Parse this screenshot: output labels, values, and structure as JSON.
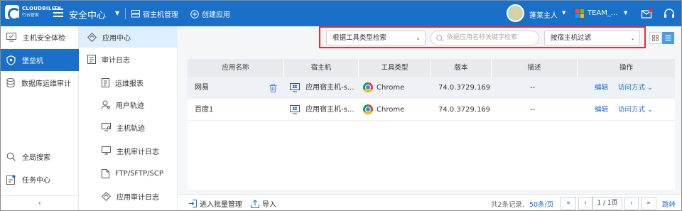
{
  "app": {
    "logo_line1": "CLOUDBILITY",
    "logo_line2": "行云管家",
    "section_title": "安全中心",
    "host_mgmt_label": "宿主机管理",
    "create_app_label": "创建应用",
    "user_name": "蓬莱主人",
    "team_label": "TEAM_..."
  },
  "sidebar": {
    "items": [
      {
        "label": "主机安全体检",
        "icon": "monitor-check-icon"
      },
      {
        "label": "堡垒机",
        "icon": "shield-icon",
        "active": true
      },
      {
        "label": "数据库运维审计",
        "icon": "database-icon"
      },
      {
        "label": "全局搜索",
        "icon": "search-icon"
      },
      {
        "label": "任务中心",
        "icon": "task-icon"
      }
    ],
    "collapse_label": "‹"
  },
  "submenu": {
    "items": [
      {
        "label": "应用中心",
        "icon": "app-center-icon",
        "active": true
      },
      {
        "label": "审计日志",
        "icon": "audit-log-icon"
      },
      {
        "label": "运维报表",
        "icon": "report-icon"
      },
      {
        "label": "用户轨迹",
        "icon": "user-track-icon"
      },
      {
        "label": "主机轨迹",
        "icon": "host-track-icon"
      },
      {
        "label": "主机审计日志",
        "icon": "host-audit-icon"
      },
      {
        "label": "FTP/SFTP/SCP",
        "icon": "ftp-icon"
      },
      {
        "label": "应用审计日志",
        "icon": "app-audit-icon"
      }
    ]
  },
  "filters": {
    "tool_type": "根据工具类型检索",
    "search_placeholder": "依据应用名称关键字检索",
    "host_filter": "按宿主机过滤"
  },
  "table": {
    "headers": [
      "应用名称",
      "宿主机",
      "工具类型",
      "版本",
      "描述",
      "操作"
    ],
    "rows": [
      {
        "name": "网易",
        "host": "应用宿主机-s...",
        "tool": "Chrome",
        "version": "74.0.3729.169",
        "desc": "--",
        "edit": "编辑",
        "access": "访问方式"
      },
      {
        "name": "百度1",
        "host": "应用宿主机-s...",
        "tool": "Chrome",
        "version": "74.0.3729.169",
        "desc": "--",
        "edit": "编辑",
        "access": "访问方式"
      }
    ]
  },
  "footer": {
    "batch_label": "进入批量管理",
    "import_label": "导入",
    "total_text": "共2条记录,",
    "page_size": "50条/页",
    "page_indicator": "1 / 1页",
    "jump_label": "跳转"
  },
  "colors": {
    "brand": "#1a6fc9",
    "highlight_border": "#e43030"
  }
}
